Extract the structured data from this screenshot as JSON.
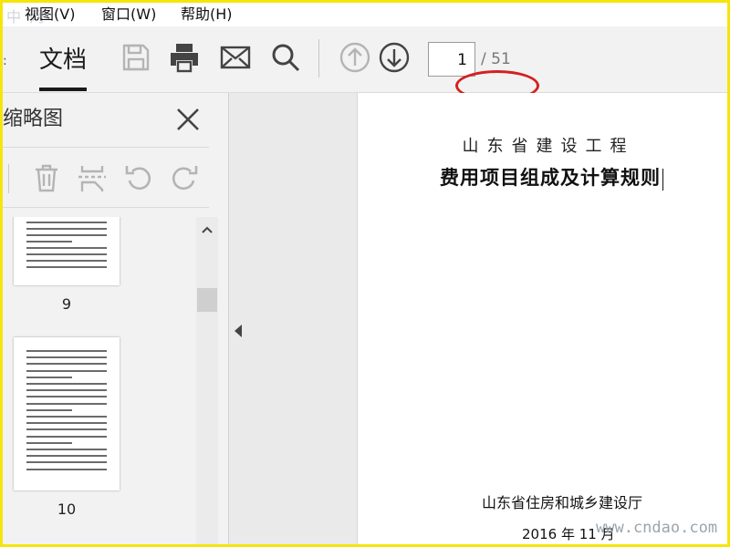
{
  "watermark_top": "中 网",
  "watermark_bottom": "www.cndao.com",
  "menu": {
    "items": [
      {
        "label": "视图(V)"
      },
      {
        "label": "窗口(W)"
      },
      {
        "label": "帮助(H)"
      }
    ]
  },
  "toolbar": {
    "overflow_dot": ":",
    "tab_label": "文档",
    "icons": [
      "save-icon",
      "print-icon",
      "mail-icon",
      "search-icon",
      "page-up-icon",
      "page-down-icon"
    ],
    "current_page": "1",
    "page_total": "/ 51"
  },
  "sidebar": {
    "title": "缩略图",
    "tools": [
      "delete-icon",
      "extract-icon",
      "rotate-left-icon",
      "rotate-right-icon"
    ],
    "thumbnails": [
      {
        "label": "9"
      },
      {
        "label": "10"
      }
    ]
  },
  "document": {
    "subtitle": "山东省建设工程",
    "title": "费用项目组成及计算规则",
    "org": "山东省住房和城乡建设厅",
    "date": "2016 年 11 月"
  },
  "colors": {
    "annotation_ellipse": "#d42020",
    "frame_border": "#f5e50c",
    "toolbar_bg": "#f2f2f2"
  }
}
